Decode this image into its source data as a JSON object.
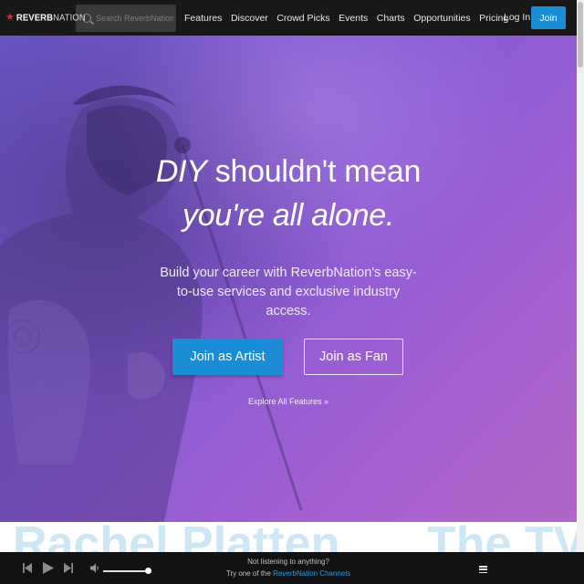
{
  "nav": {
    "logo_star": "★",
    "logo_reverb": "REVERB",
    "logo_nation": "NATION",
    "search_placeholder": "Search ReverbNation",
    "items": [
      "Features",
      "Discover",
      "Crowd Picks",
      "Events",
      "Charts",
      "Opportunities",
      "Pricing"
    ],
    "login": "Log In",
    "join": "Join",
    "join_color": "#1a8dd6"
  },
  "hero": {
    "line1_em": "DIY",
    "line1_rest": " shouldn't mean",
    "line2": "you're all alone.",
    "subtitle": "Build your career with ReverbNation's easy-to-use services and exclusive industry access.",
    "join_artist": "Join as Artist",
    "join_fan": "Join as Fan",
    "explore": "Explore All Features »",
    "gradient_start": "#6b56c8",
    "gradient_end": "#b066c8"
  },
  "peek": {
    "text1": "Rachel Platten",
    "text2": "The TV"
  },
  "player": {
    "status1": "Not listening to anything?",
    "status2_prefix": "Try one of the ",
    "status2_link": "ReverbNation Channels",
    "link_color": "#2f9be0",
    "icons": [
      "previous-icon",
      "play-icon",
      "next-icon",
      "volume-icon",
      "menu-icon"
    ]
  }
}
